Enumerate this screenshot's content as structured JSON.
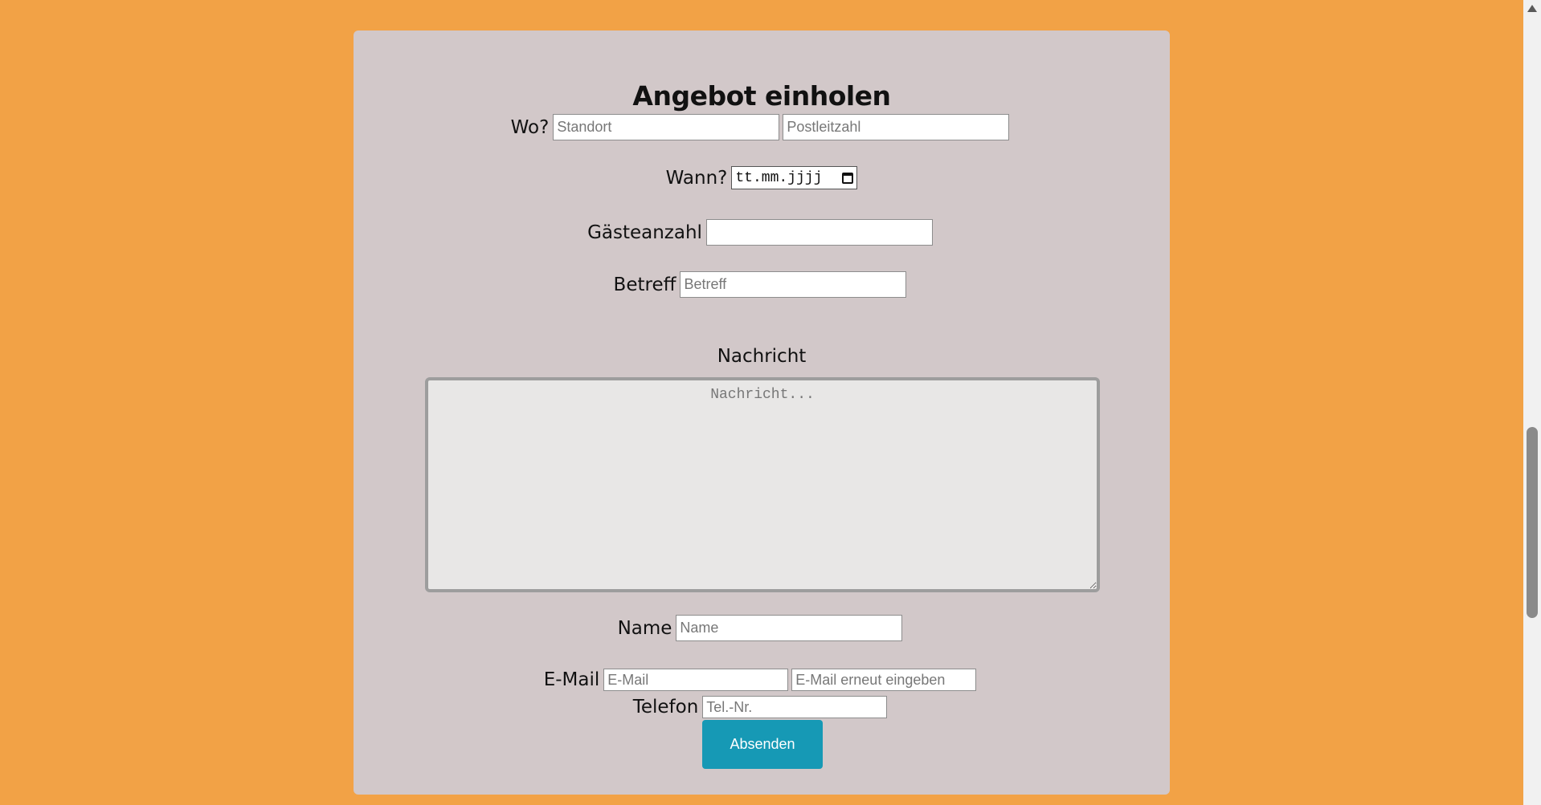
{
  "form": {
    "title": "Angebot einholen",
    "where_label": "Wo?",
    "location_placeholder": "Standort",
    "zip_placeholder": "Postleitzahl",
    "when_label": "Wann?",
    "date_value": "tt.mm.jjjj",
    "guests_label": "Gästeanzahl",
    "subject_label": "Betreff",
    "subject_placeholder": "Betreff",
    "message_label": "Nachricht",
    "message_placeholder": "Nachricht...",
    "name_label": "Name",
    "name_placeholder": "Name",
    "email_label": "E-Mail",
    "email_placeholder": "E-Mail",
    "email_confirm_placeholder": "E-Mail erneut eingeben",
    "phone_label": "Telefon",
    "phone_placeholder": "Tel.-Nr.",
    "submit_label": "Absenden"
  },
  "colors": {
    "page_background": "#f2a246",
    "card_background": "#d2c8c9",
    "button": "#1699b5"
  },
  "icons": {
    "date_picker": "calendar-icon",
    "scroll_up": "scroll-up-arrow-icon"
  }
}
